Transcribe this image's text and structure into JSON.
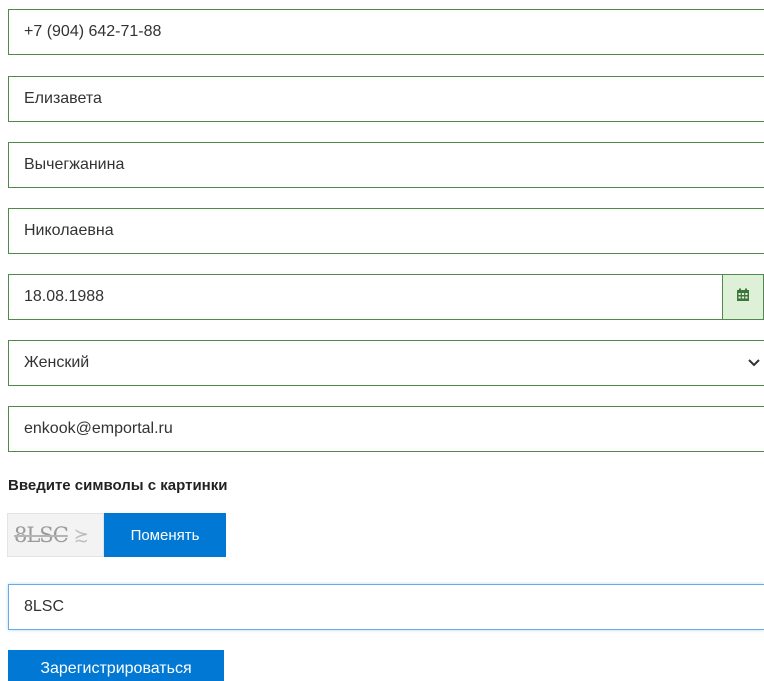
{
  "form": {
    "phone": {
      "value": "+7 (904) 642-71-88"
    },
    "first_name": {
      "value": "Елизавета"
    },
    "last_name": {
      "value": "Вычегжанина"
    },
    "middle_name": {
      "value": "Николаевна"
    },
    "birth_date": {
      "value": "18.08.1988",
      "button_icon": "calendar-icon"
    },
    "gender": {
      "selected": "Женский",
      "icon": "chevron-down-icon"
    },
    "email": {
      "value": "enkook@emportal.ru"
    },
    "captcha": {
      "label": "Введите символы с картинки",
      "image_text": "8LSC",
      "image_glyph": "≿",
      "change_label": "Поменять",
      "input_value": "8LSC"
    },
    "submit_label": "Зарегистрироваться"
  },
  "colors": {
    "field_border": "#4f8a4a",
    "calendar_bg": "#dff0d8",
    "calendar_icon": "#3c763d",
    "button_blue": "#0078d4",
    "focus_border": "#6aa9e8"
  }
}
